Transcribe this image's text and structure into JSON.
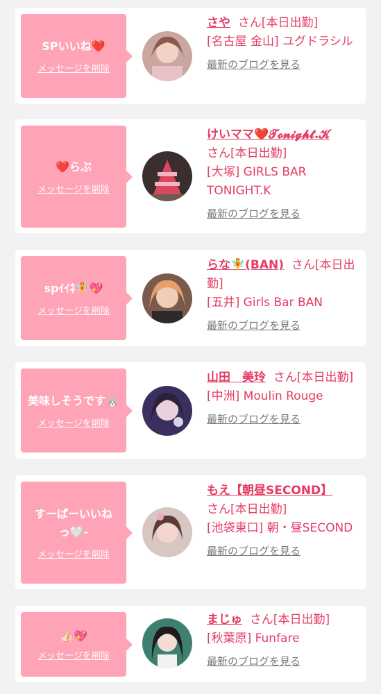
{
  "delete_label": "メッセージを削除",
  "blog_label": "最新のブログを見る",
  "cards": [
    {
      "message": "SPいいね❤️",
      "name": "さや",
      "status": "さん[本日出勤]",
      "shop": "[名古屋 金山] ユグドラシル"
    },
    {
      "message": "❤️らぶ",
      "name": "けいママ❤️𝓣𝓸𝓷𝓲𝓰𝓱𝓽.𝓚",
      "status": "さん[本日出勤]",
      "shop": "[大塚] GIRLS BAR TONIGHT.K"
    },
    {
      "message": "spｲｲﾈ🧚💖",
      "name": "らな🧚(BAN)",
      "status": "さん[本日出勤]",
      "shop": "[五井] Girls Bar BAN"
    },
    {
      "message": "美味しそうです🐰",
      "name": "山田　美玲",
      "status": "さん[本日出勤]",
      "shop": "[中洲] Moulin Rouge"
    },
    {
      "message": "すーぱーいいねっ🤍‐",
      "name": "もえ【朝昼SECOND】",
      "status": "さん[本日出勤]",
      "shop": "[池袋東口] 朝・昼SECOND"
    },
    {
      "message": "👍🏻💖",
      "name": "まじゅ",
      "status": "さん[本日出勤]",
      "shop": "[秋葉原] Funfare"
    }
  ],
  "colors": {
    "bubble": "#ffa3b6",
    "accent": "#e53c64",
    "link_gray": "#777777"
  }
}
